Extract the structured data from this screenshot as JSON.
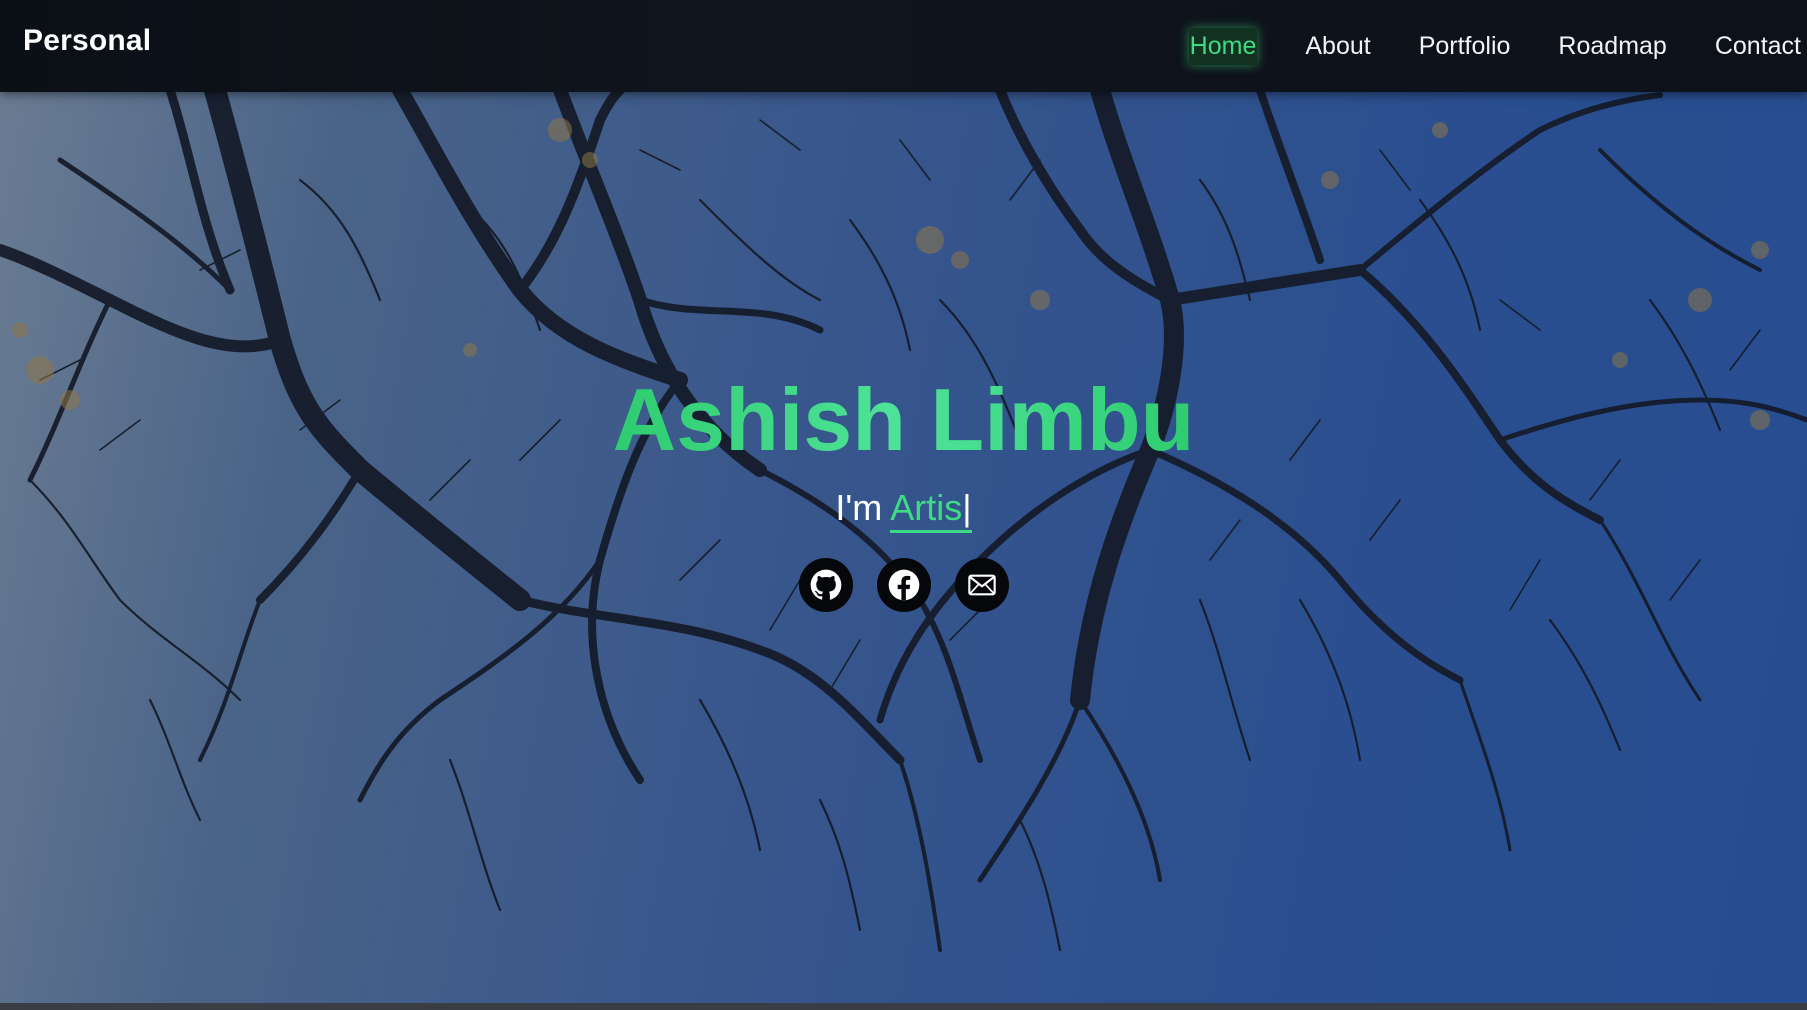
{
  "navbar": {
    "brand": "Personal",
    "links": [
      {
        "label": "Home",
        "active": true
      },
      {
        "label": "About",
        "active": false
      },
      {
        "label": "Portfolio",
        "active": false
      },
      {
        "label": "Roadmap",
        "active": false
      },
      {
        "label": "Contact",
        "active": false
      }
    ]
  },
  "hero": {
    "name": "Ashish Limbu",
    "typed_prefix": "I'm ",
    "typed_word": "Artis",
    "typed_cursor": "|",
    "socials": [
      {
        "icon": "github-icon"
      },
      {
        "icon": "facebook-icon"
      },
      {
        "icon": "mail-icon"
      }
    ]
  },
  "colors": {
    "accent": "#3ddc84",
    "navbar_bg": "#0d1119",
    "sky": "#2f5aa5"
  }
}
